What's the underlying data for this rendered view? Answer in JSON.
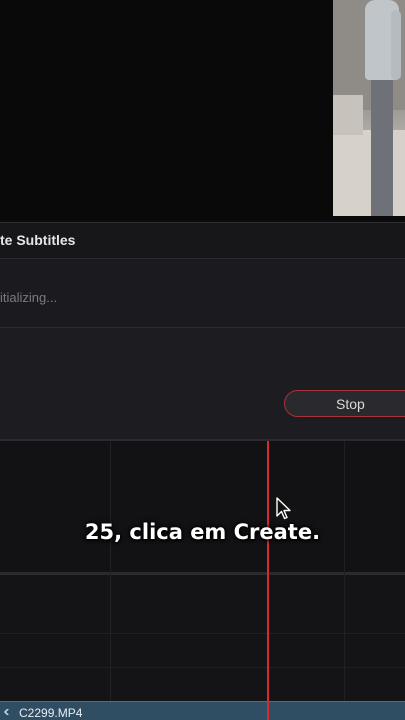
{
  "dialog": {
    "title": "te Subtitles",
    "status": "itializing...",
    "stop_label": "Stop"
  },
  "timeline": {
    "clip_name": "C2299.MP4"
  },
  "caption": {
    "text": "25, clica em Create."
  },
  "colors": {
    "playhead": "#d42b31",
    "stop_border": "#a8323a",
    "clip": "#2f4d63"
  },
  "icons": {
    "cursor": "mouse-cursor-icon",
    "clip": "clip-link-icon"
  }
}
